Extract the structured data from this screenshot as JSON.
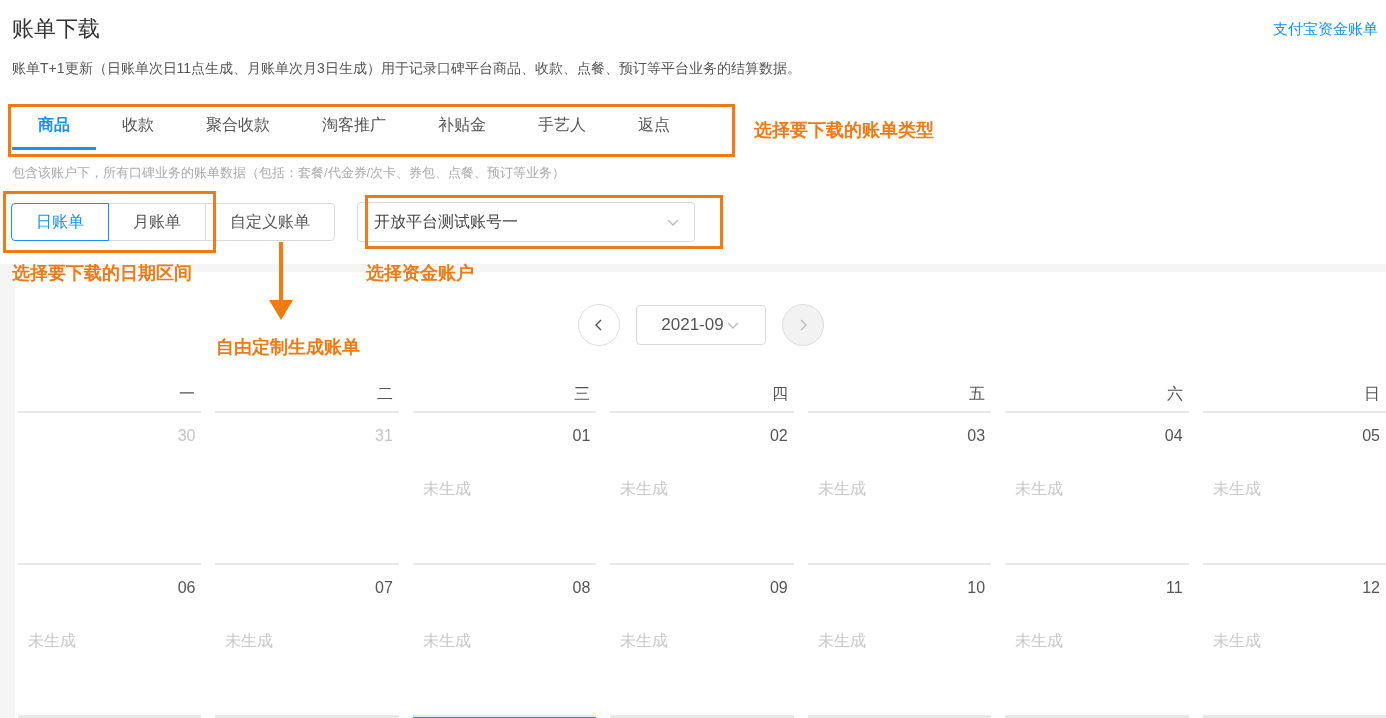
{
  "header": {
    "title": "账单下载",
    "link": "支付宝资金账单",
    "description": "账单T+1更新（日账单次日11点生成、月账单次月3日生成）用于记录口碑平台商品、收款、点餐、预订等平台业务的结算数据。"
  },
  "tabs": [
    {
      "label": "商品",
      "selected": true
    },
    {
      "label": "收款",
      "selected": false
    },
    {
      "label": "聚合收款",
      "selected": false
    },
    {
      "label": "淘客推广",
      "selected": false
    },
    {
      "label": "补贴金",
      "selected": false
    },
    {
      "label": "手艺人",
      "selected": false
    },
    {
      "label": "返点",
      "selected": false
    }
  ],
  "tab_hint": "包含该账户下，所有口碑业务的账单数据（包括：套餐/代金券/次卡、券包、点餐、预订等业务）",
  "period_buttons": [
    {
      "label": "日账单",
      "selected": true
    },
    {
      "label": "月账单",
      "selected": false
    },
    {
      "label": "自定义账单",
      "selected": false
    }
  ],
  "account_select": {
    "value": "开放平台测试账号一"
  },
  "annotations": {
    "tabs_note": "选择要下载的账单类型",
    "period_note": "选择要下载的日期区间",
    "account_note": "选择资金账户",
    "custom_note": "自由定制生成账单"
  },
  "calendar": {
    "month": "2021-09",
    "prev_disabled": false,
    "next_disabled": true,
    "weekdays": [
      "一",
      "二",
      "三",
      "四",
      "五",
      "六",
      "日"
    ],
    "weeks": [
      [
        {
          "day": "30",
          "outside": true
        },
        {
          "day": "31",
          "outside": true
        },
        {
          "day": "01",
          "outside": false,
          "status": "未生成"
        },
        {
          "day": "02",
          "outside": false,
          "status": "未生成"
        },
        {
          "day": "03",
          "outside": false,
          "status": "未生成"
        },
        {
          "day": "04",
          "outside": false,
          "status": "未生成"
        },
        {
          "day": "05",
          "outside": false,
          "status": "未生成"
        }
      ],
      [
        {
          "day": "06",
          "outside": false,
          "status": "未生成"
        },
        {
          "day": "07",
          "outside": false,
          "status": "未生成"
        },
        {
          "day": "08",
          "outside": false,
          "status": "未生成"
        },
        {
          "day": "09",
          "outside": false,
          "status": "未生成"
        },
        {
          "day": "10",
          "outside": false,
          "status": "未生成"
        },
        {
          "day": "11",
          "outside": false,
          "status": "未生成"
        },
        {
          "day": "12",
          "outside": false,
          "status": "未生成"
        }
      ]
    ],
    "next_week_cells": [
      {
        "selected": false
      },
      {
        "selected": false
      },
      {
        "selected": true
      },
      {
        "selected": false
      },
      {
        "selected": false
      },
      {
        "selected": false
      },
      {
        "selected": false
      }
    ]
  }
}
